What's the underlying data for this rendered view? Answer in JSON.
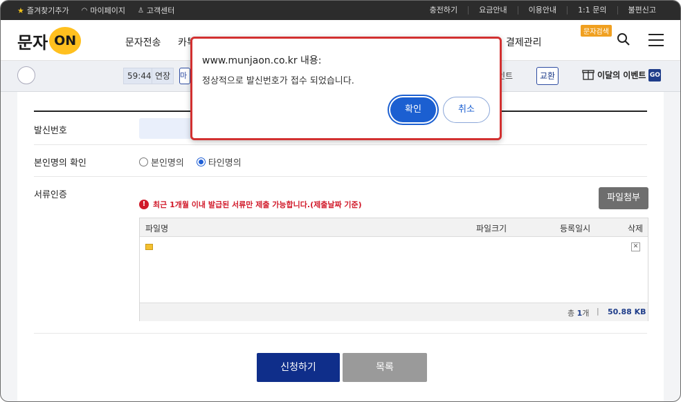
{
  "topbar": {
    "favorites": "즐겨찾기추가",
    "mypage": "마이페이지",
    "support": "고객센터",
    "links": [
      "충전하기",
      "요금안내",
      "이용안내",
      "1:1 문의",
      "불편신고"
    ]
  },
  "header": {
    "logo_ko": "문자",
    "logo_on": "ON",
    "nav": [
      "문자전송",
      "카톡",
      "결제관리"
    ],
    "search_tag": "문자검색"
  },
  "subbar": {
    "timer": "59:44",
    "extend": "연장",
    "mi_btn": "마",
    "point": "인트",
    "exchange": "교환",
    "event": "이달의 이벤트",
    "go": "GO"
  },
  "form": {
    "sender_label": "발신번호",
    "identity_label": "본인명의 확인",
    "identity_options": [
      "본인명의",
      "타인명의"
    ],
    "selected_option": "타인명의",
    "docs_label": "서류인증",
    "attach_button": "파일첨부",
    "warning": "최근 1개월 이내 발급된 서류만 제출 가능합니다.(제출날짜 기준)",
    "table_headers": [
      "파일명",
      "파일크기",
      "등록일시",
      "삭제"
    ],
    "total_prefix": "총",
    "total_count": "1",
    "total_unit": "개",
    "total_size": "50.88 KB",
    "submit_button": "신청하기",
    "list_button": "목록"
  },
  "dialog": {
    "title": "www.munjaon.co.kr 내용:",
    "message": "정상적으로 발신번호가 접수 되었습니다.",
    "ok": "확인",
    "cancel": "취소"
  },
  "colors": {
    "accent": "#1b5fd1",
    "navy": "#0f2e8a",
    "logo_yellow": "#ffc01f",
    "warning_red": "#d11a2a",
    "dialog_border": "#d23030"
  }
}
